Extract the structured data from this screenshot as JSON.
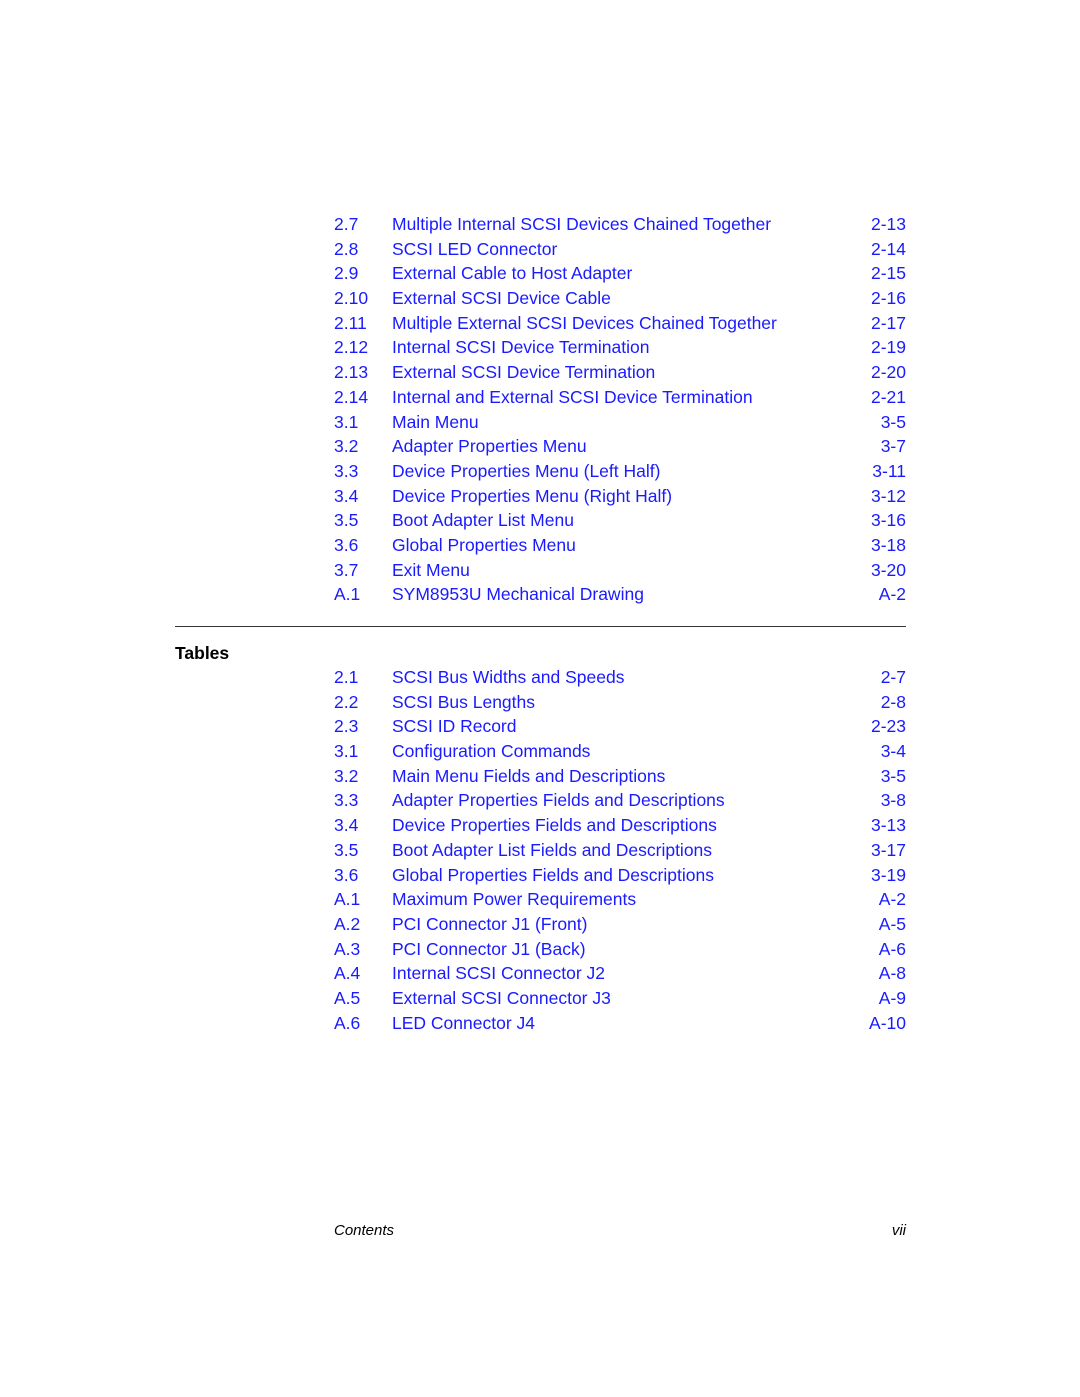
{
  "colors": {
    "link": "#1a1aff",
    "text": "#000000",
    "rule": "#333333"
  },
  "figures": [
    {
      "num": "2.7",
      "title": "Multiple Internal SCSI Devices Chained Together",
      "page": "2-13"
    },
    {
      "num": "2.8",
      "title": "SCSI LED Connector",
      "page": "2-14"
    },
    {
      "num": "2.9",
      "title": "External Cable to Host Adapter",
      "page": "2-15"
    },
    {
      "num": "2.10",
      "title": "External SCSI Device Cable",
      "page": "2-16"
    },
    {
      "num": "2.11",
      "title": "Multiple External SCSI Devices Chained Together",
      "page": "2-17"
    },
    {
      "num": "2.12",
      "title": "Internal SCSI Device Termination",
      "page": "2-19"
    },
    {
      "num": "2.13",
      "title": "External SCSI Device Termination",
      "page": "2-20"
    },
    {
      "num": "2.14",
      "title": "Internal and External SCSI Device Termination",
      "page": "2-21"
    },
    {
      "num": "3.1",
      "title": "Main Menu",
      "page": "3-5"
    },
    {
      "num": "3.2",
      "title": "Adapter Properties Menu",
      "page": "3-7"
    },
    {
      "num": "3.3",
      "title": "Device Properties Menu (Left Half)",
      "page": "3-11"
    },
    {
      "num": "3.4",
      "title": "Device Properties Menu (Right Half)",
      "page": "3-12"
    },
    {
      "num": "3.5",
      "title": "Boot Adapter List Menu",
      "page": "3-16"
    },
    {
      "num": "3.6",
      "title": "Global Properties Menu",
      "page": "3-18"
    },
    {
      "num": "3.7",
      "title": "Exit Menu",
      "page": "3-20"
    },
    {
      "num": "A.1",
      "title": "SYM8953U Mechanical Drawing",
      "page": "A-2"
    }
  ],
  "tables_heading": "Tables",
  "tables": [
    {
      "num": "2.1",
      "title": "SCSI Bus Widths and Speeds",
      "page": "2-7"
    },
    {
      "num": "2.2",
      "title": "SCSI Bus Lengths",
      "page": "2-8"
    },
    {
      "num": "2.3",
      "title": "SCSI ID Record",
      "page": "2-23"
    },
    {
      "num": "3.1",
      "title": "Configuration Commands",
      "page": "3-4"
    },
    {
      "num": "3.2",
      "title": "Main Menu Fields and Descriptions",
      "page": "3-5"
    },
    {
      "num": "3.3",
      "title": "Adapter Properties Fields and Descriptions",
      "page": "3-8"
    },
    {
      "num": "3.4",
      "title": "Device Properties Fields and Descriptions",
      "page": "3-13"
    },
    {
      "num": "3.5",
      "title": "Boot Adapter List Fields and Descriptions",
      "page": "3-17"
    },
    {
      "num": "3.6",
      "title": "Global Properties Fields and Descriptions",
      "page": "3-19"
    },
    {
      "num": "A.1",
      "title": "Maximum Power Requirements",
      "page": "A-2"
    },
    {
      "num": "A.2",
      "title": "PCI Connector J1 (Front)",
      "page": "A-5"
    },
    {
      "num": "A.3",
      "title": "PCI Connector J1 (Back)",
      "page": "A-6"
    },
    {
      "num": "A.4",
      "title": "Internal SCSI Connector J2",
      "page": "A-8"
    },
    {
      "num": "A.5",
      "title": "External SCSI Connector J3",
      "page": "A-9"
    },
    {
      "num": "A.6",
      "title": "LED Connector J4",
      "page": "A-10"
    }
  ],
  "footer": {
    "section": "Contents",
    "page_number": "vii"
  }
}
